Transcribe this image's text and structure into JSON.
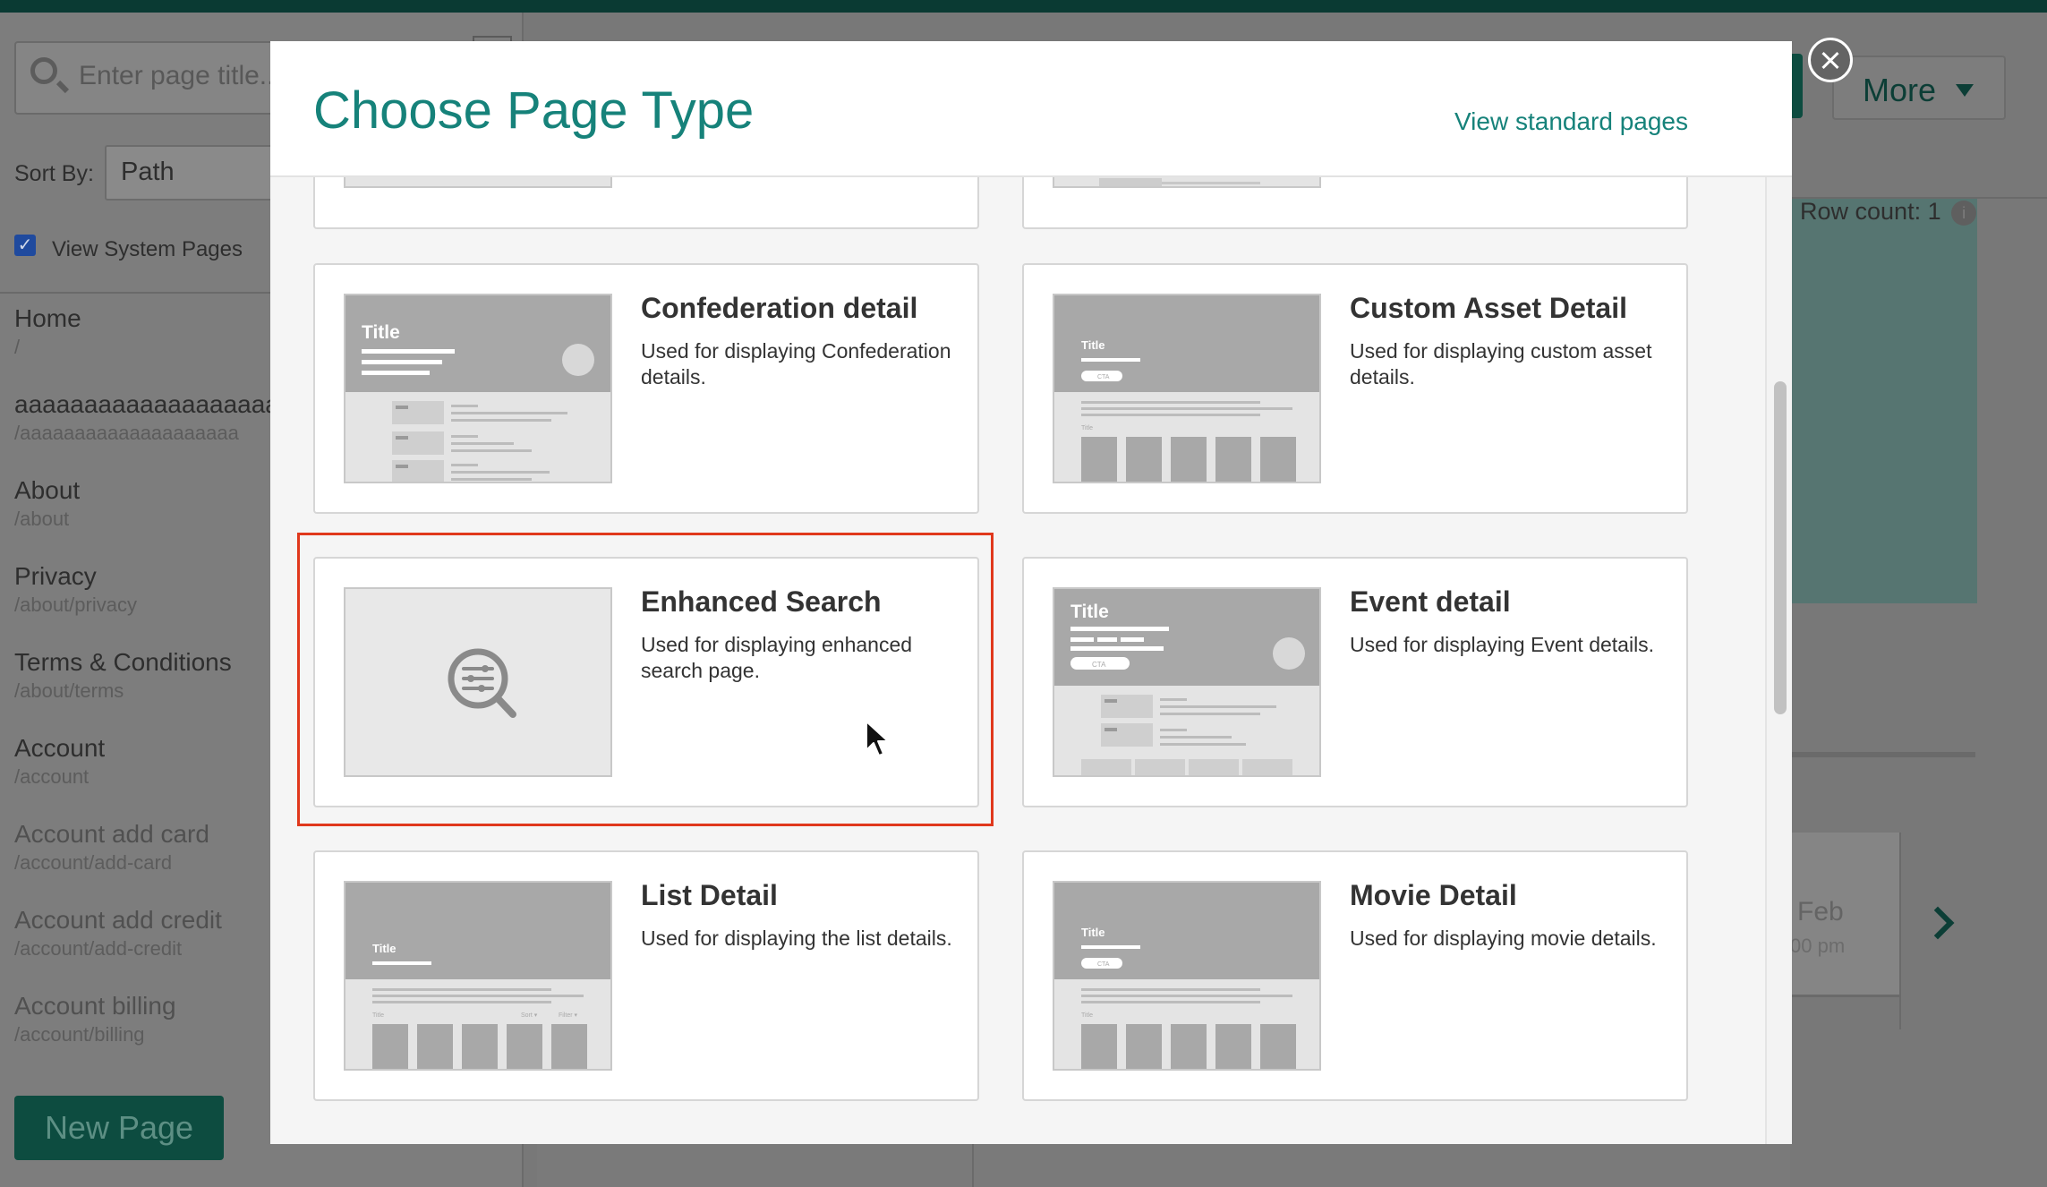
{
  "background": {
    "search": {
      "placeholder": "Enter page title..."
    },
    "sort": {
      "label": "Sort By:",
      "value": "Path"
    },
    "view_system_pages": {
      "label": "View System Pages",
      "checked": true
    },
    "nav_items": [
      {
        "title": "Home",
        "path": "/"
      },
      {
        "title": "aaaaaaaaaaaaaaaaaaa",
        "path": "/aaaaaaaaaaaaaaaaaaaa"
      },
      {
        "title": "About",
        "path": "/about"
      },
      {
        "title": "Privacy",
        "path": "/about/privacy"
      },
      {
        "title": "Terms & Conditions",
        "path": "/about/terms"
      },
      {
        "title": "Account",
        "path": "/account"
      },
      {
        "title": "Account add card",
        "path": "/account/add-card"
      },
      {
        "title": "Account add credit",
        "path": "/account/add-credit"
      },
      {
        "title": "Account billing",
        "path": "/account/billing"
      }
    ],
    "new_page_label": "New Page",
    "more_label": "More",
    "row_count_label": "Row count: 1",
    "info_glyph": "i",
    "date_label": "Feb",
    "time_label": "00 pm"
  },
  "modal": {
    "title": "Choose Page Type",
    "view_standard_link": "View standard pages",
    "close_icon": "close-icon",
    "cards": [
      {
        "title": "Confederation detail",
        "description": "Used for displaying Confederation details."
      },
      {
        "title": "Custom Asset Detail",
        "description": "Used for displaying custom asset details."
      },
      {
        "title": "Enhanced Search",
        "description": "Used for displaying enhanced search page."
      },
      {
        "title": "Event detail",
        "description": "Used for displaying Event details."
      },
      {
        "title": "List Detail",
        "description": "Used for displaying the list details."
      },
      {
        "title": "Movie Detail",
        "description": "Used for displaying movie details."
      }
    ],
    "thumbnails": {
      "title": "Title",
      "cta": "CTA",
      "list_title": "Title",
      "sort": "Sort ▾",
      "filter": "Filter ▾"
    }
  },
  "colors": {
    "accent": "#16827a",
    "highlight": "#e0381c",
    "dark_green": "#0d4c40"
  }
}
